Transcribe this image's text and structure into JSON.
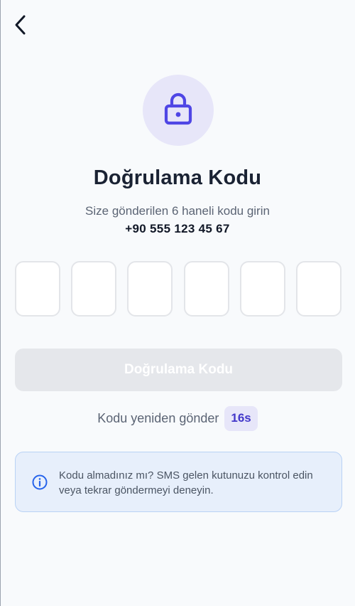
{
  "header": {
    "back_icon": "chevron-left-icon"
  },
  "hero": {
    "icon": "lock-icon",
    "accent_color": "#4f46e5",
    "circle_color": "#e7e6f9"
  },
  "title": "Doğrulama Kodu",
  "subtitle": "Size gönderilen 6 haneli kodu girin",
  "phone": "+90 555 123 45 67",
  "otp": {
    "length": 6,
    "digits": [
      "",
      "",
      "",
      "",
      "",
      ""
    ]
  },
  "verify_button": {
    "label": "Doğrulama Kodu",
    "disabled": true
  },
  "resend": {
    "label": "Kodu yeniden gönder",
    "countdown": "16s"
  },
  "info": {
    "icon": "info-icon",
    "text": "Kodu almadınız mı? SMS gelen kutunuzu kontrol edin veya tekrar göndermeyi deneyin."
  }
}
